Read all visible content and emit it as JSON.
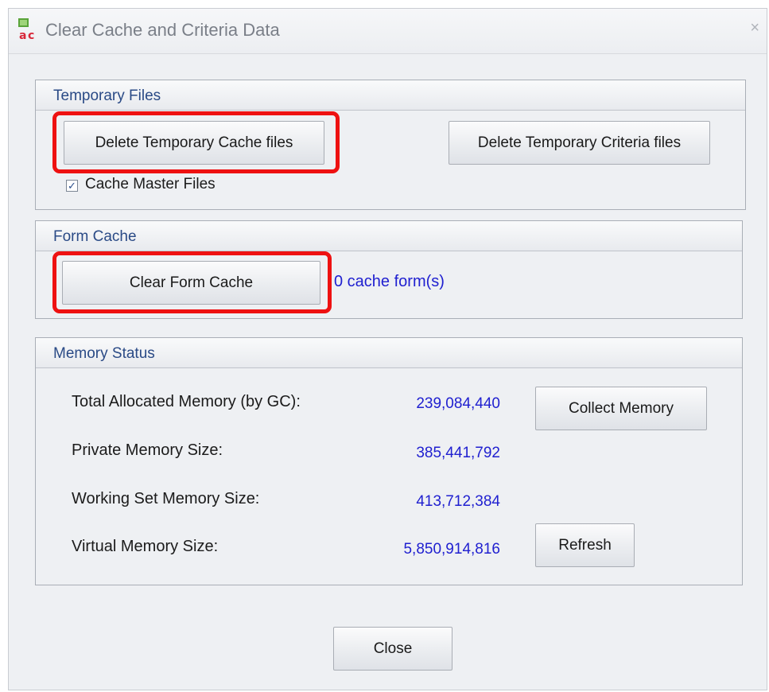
{
  "window": {
    "title": "Clear Cache and Criteria Data",
    "close_glyph": "×"
  },
  "temporary_files": {
    "title": "Temporary Files",
    "delete_cache_label": "Delete Temporary Cache files",
    "delete_criteria_label": "Delete Temporary Criteria files",
    "cache_master_label": "Cache Master Files",
    "cache_master_checked": true,
    "check_glyph": "✓"
  },
  "form_cache": {
    "title": "Form Cache",
    "clear_label": "Clear Form Cache",
    "count_text": "0 cache form(s)"
  },
  "memory_status": {
    "title": "Memory Status",
    "rows": [
      {
        "label": "Total Allocated Memory (by GC):",
        "value": "239,084,440"
      },
      {
        "label": "Private Memory Size:",
        "value": "385,441,792"
      },
      {
        "label": "Working Set Memory Size:",
        "value": "413,712,384"
      },
      {
        "label": "Virtual Memory Size:",
        "value": "5,850,914,816"
      }
    ],
    "collect_label": "Collect Memory",
    "refresh_label": "Refresh"
  },
  "footer": {
    "close_label": "Close"
  },
  "colors": {
    "accent_title": "#2a4a86",
    "value_blue": "#2020d0",
    "highlight_red": "#ee1111"
  },
  "icons": {
    "app": "app-icon"
  }
}
